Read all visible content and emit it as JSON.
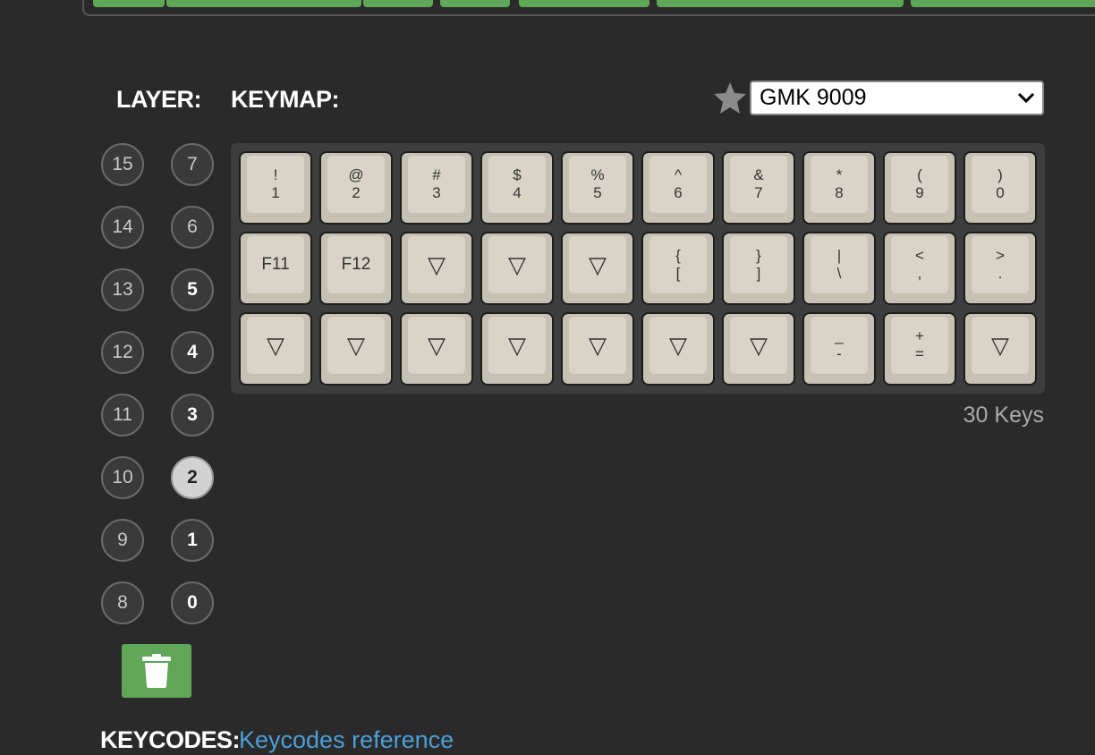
{
  "colors": {
    "accent_green": "#5fa657",
    "background": "#2a2a2a",
    "link": "#4a9fd8"
  },
  "header": {
    "layer_label": "LAYER:",
    "keymap_label": "KEYMAP:"
  },
  "keymap_select": {
    "selected": "GMK 9009",
    "favorite_icon": "star-icon"
  },
  "layers": {
    "col_left": [
      "15",
      "14",
      "13",
      "12",
      "11",
      "10",
      "9",
      "8"
    ],
    "col_right": [
      "7",
      "6",
      "5",
      "4",
      "3",
      "2",
      "1",
      "0"
    ],
    "active": "2"
  },
  "keys": [
    [
      "!",
      "1"
    ],
    [
      "@",
      "2"
    ],
    [
      "#",
      "3"
    ],
    [
      "$",
      "4"
    ],
    [
      "%",
      "5"
    ],
    [
      "^",
      "6"
    ],
    [
      "&",
      "7"
    ],
    [
      "*",
      "8"
    ],
    [
      "(",
      "9"
    ],
    [
      ")",
      "0"
    ],
    [
      "F11"
    ],
    [
      "F12"
    ],
    [
      "▽"
    ],
    [
      "▽"
    ],
    [
      "▽"
    ],
    [
      "{",
      "["
    ],
    [
      "}",
      "]"
    ],
    [
      "|",
      "\\"
    ],
    [
      "<",
      ","
    ],
    [
      ">",
      "."
    ],
    [
      "▽"
    ],
    [
      "▽"
    ],
    [
      "▽"
    ],
    [
      "▽"
    ],
    [
      "▽"
    ],
    [
      "▽"
    ],
    [
      "▽"
    ],
    [
      "_",
      "-"
    ],
    [
      "+",
      "="
    ],
    [
      "▽"
    ]
  ],
  "key_count": "30 Keys",
  "footer": {
    "keycodes_label": "KEYCODES:",
    "reference_link": "Keycodes reference"
  },
  "trash_icon": "trash-icon"
}
